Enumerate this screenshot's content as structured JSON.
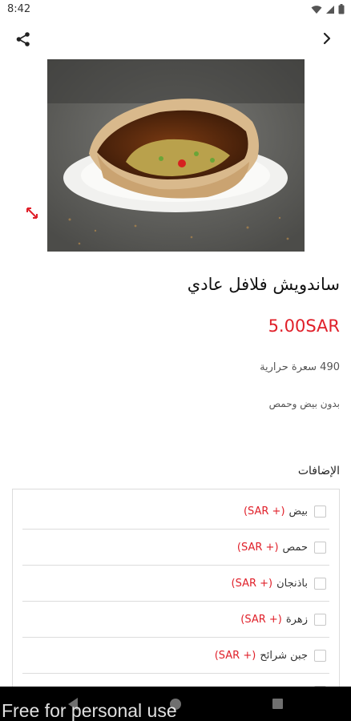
{
  "status_bar": {
    "time": "8:42"
  },
  "product": {
    "title": "ساندويش فلافل عادي",
    "price": "5.00SAR",
    "calories": "490 سعرة حرارية",
    "description": "بدون بيض وحمص"
  },
  "addons": {
    "title": "الإضافات",
    "items": [
      {
        "name": "بيض",
        "extra": "(SAR +)"
      },
      {
        "name": "حمص",
        "extra": "(SAR +)"
      },
      {
        "name": "باذنجان",
        "extra": "(SAR +)"
      },
      {
        "name": "زهرة",
        "extra": "(SAR +)"
      },
      {
        "name": "جبن شرائح",
        "extra": "(SAR +)"
      }
    ]
  },
  "watermark": "Free for personal use",
  "colors": {
    "accent": "#e0202a",
    "text": "#111111",
    "nav_bar": "#000000"
  }
}
